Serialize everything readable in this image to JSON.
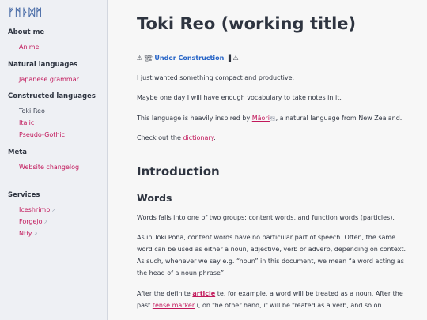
{
  "sidebar": {
    "logo": "ᚠᛗᚦᛞᛗ",
    "sections": [
      {
        "heading": "About me",
        "items": [
          "Anime"
        ]
      },
      {
        "heading": "Natural languages",
        "items": [
          "Japanese grammar"
        ]
      },
      {
        "heading": "Constructed languages",
        "items": [
          "Toki Reo",
          "Italic",
          "Pseudo-Gothic"
        ]
      },
      {
        "heading": "Meta",
        "items": [
          "Website changelog"
        ]
      },
      {
        "heading": "Services",
        "items": [
          "Iceshrimp",
          "Forgejo",
          "Ntfy"
        ]
      }
    ],
    "external_icon": "↗"
  },
  "page": {
    "title": "Toki Reo (working title)",
    "notice_prefix": "⚠ 🏗",
    "notice_text": "Under Construction",
    "notice_suffix": "▐ ⚠",
    "para1": "I just wanted something compact and productive.",
    "para2": "Maybe one day I will have enough vocabulary to take notes in it.",
    "para3_a": "This language is heavily inspired by ",
    "para3_link": "Māori",
    "para3_mark": "🗺",
    "para3_b": ", a natural language from New Zealand.",
    "para4_a": "Check out the ",
    "para4_link": "dictionary",
    "para4_b": ".",
    "h_intro": "Introduction",
    "h_words": "Words",
    "para5": "Words falls into one of two groups: content words, and function words (particles).",
    "para6": "As in Toki Pona, content words have no particular part of speech. Often, the same word can be used as either a noun, adjective, verb or adverb, depending on context. As such, whenever we say e.g. “noun” in this document, we mean “a word acting as the head of a noun phrase”.",
    "para7_a": "After the definite ",
    "para7_link1": "article",
    "para7_b": " te, for example, a word will be treated as a noun. After the past ",
    "para7_link2": "tense marker",
    "para7_c": " i, on the other hand, it will be treated as a verb, and so on."
  },
  "colors": {
    "accent": "#c2185b",
    "notice": "#2563c6",
    "sidebar_bg": "#eef0f4",
    "page_bg": "#f7f7f7",
    "text": "#2e3440"
  }
}
